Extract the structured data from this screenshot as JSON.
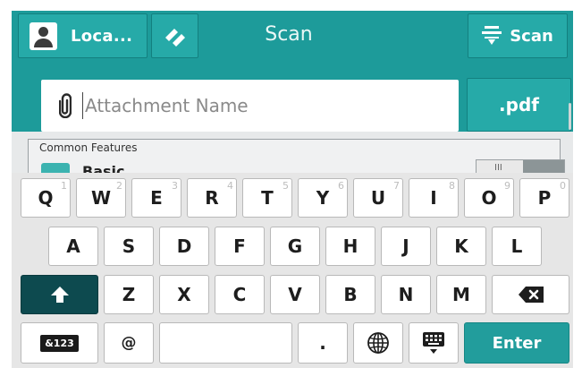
{
  "header": {
    "user_button_label": "Loca...",
    "title": "Scan",
    "scan_button_label": "Scan",
    "icons": {
      "user": "user-avatar-icon",
      "swap": "swap-slashes-icon",
      "scan": "scan-tray-icon",
      "attachment": "paperclip-icon"
    }
  },
  "attachment": {
    "placeholder": "Attachment Name",
    "value": "",
    "extension_label": ".pdf"
  },
  "features": {
    "section_title": "Common Features",
    "first_item_label": "Basic",
    "toggle_ticks": "III"
  },
  "keyboard": {
    "row1": [
      {
        "label": "Q",
        "num": "1"
      },
      {
        "label": "W",
        "num": "2"
      },
      {
        "label": "E",
        "num": "3"
      },
      {
        "label": "R",
        "num": "4"
      },
      {
        "label": "T",
        "num": "5"
      },
      {
        "label": "Y",
        "num": "6"
      },
      {
        "label": "U",
        "num": "7"
      },
      {
        "label": "I",
        "num": "8"
      },
      {
        "label": "O",
        "num": "9"
      },
      {
        "label": "P",
        "num": "0"
      }
    ],
    "row2": [
      "A",
      "S",
      "D",
      "F",
      "G",
      "H",
      "J",
      "K",
      "L"
    ],
    "row3": [
      "Z",
      "X",
      "C",
      "V",
      "B",
      "N",
      "M"
    ],
    "symbols_label": "&123",
    "at_label": "@",
    "period_label": ".",
    "enter_label": "Enter",
    "icons": {
      "shift": "shift-arrow-icon",
      "backspace": "backspace-icon",
      "globe": "globe-icon",
      "hide": "keyboard-hide-icon"
    }
  },
  "colors": {
    "header_bg": "#1d9b9a",
    "button_bg": "#26aaa8",
    "shift_key": "#0d4a4f",
    "enter_key": "#229d9c"
  }
}
